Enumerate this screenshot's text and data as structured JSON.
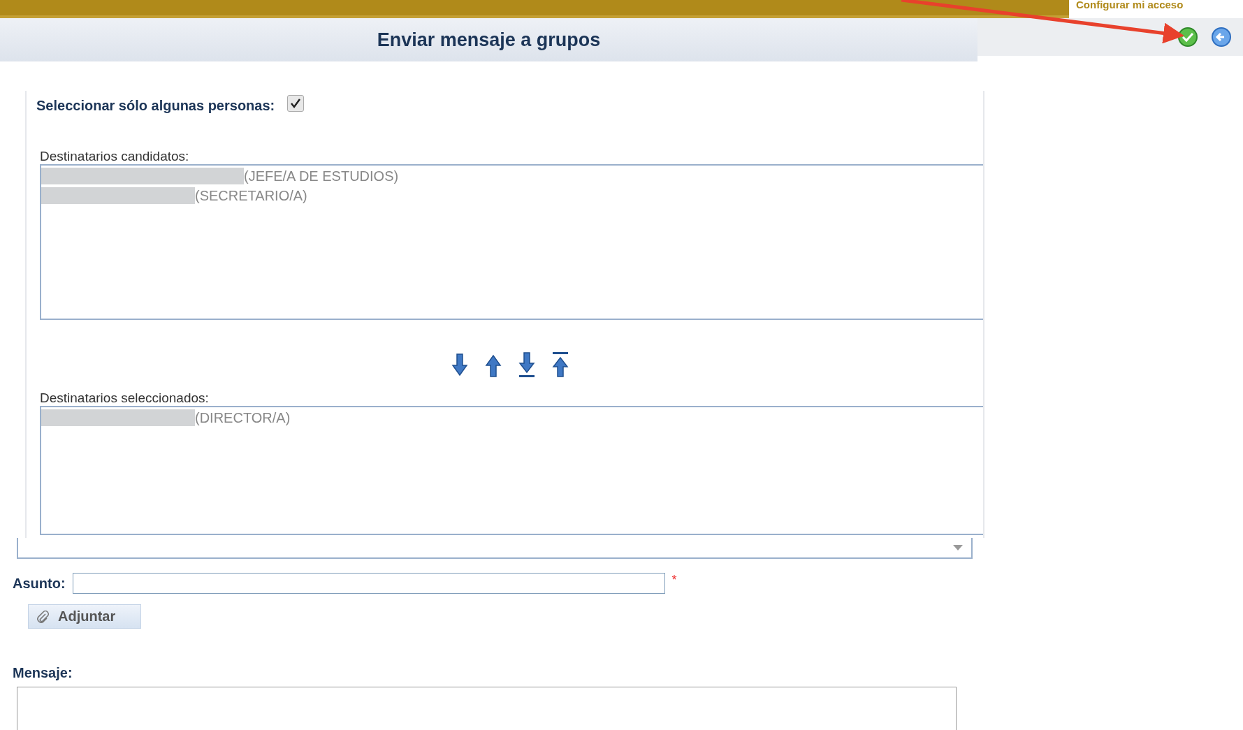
{
  "top_link": "Configurar mi acceso",
  "header": {
    "title": "Enviar mensaje a grupos"
  },
  "select_some": {
    "label": "Seleccionar sólo algunas personas:",
    "checked": true
  },
  "candidates": {
    "label": "Destinatarios candidatos:",
    "items": [
      {
        "role": "(JEFE/A DE ESTUDIOS)"
      },
      {
        "role": "(SECRETARIO/A)"
      }
    ]
  },
  "selected": {
    "label": "Destinatarios seleccionados:",
    "items": [
      {
        "role": "(DIRECTOR/A)"
      }
    ]
  },
  "subject": {
    "label": "Asunto:",
    "required_mark": "*"
  },
  "attach_button": "Adjuntar",
  "message": {
    "label": "Mensaje:"
  }
}
